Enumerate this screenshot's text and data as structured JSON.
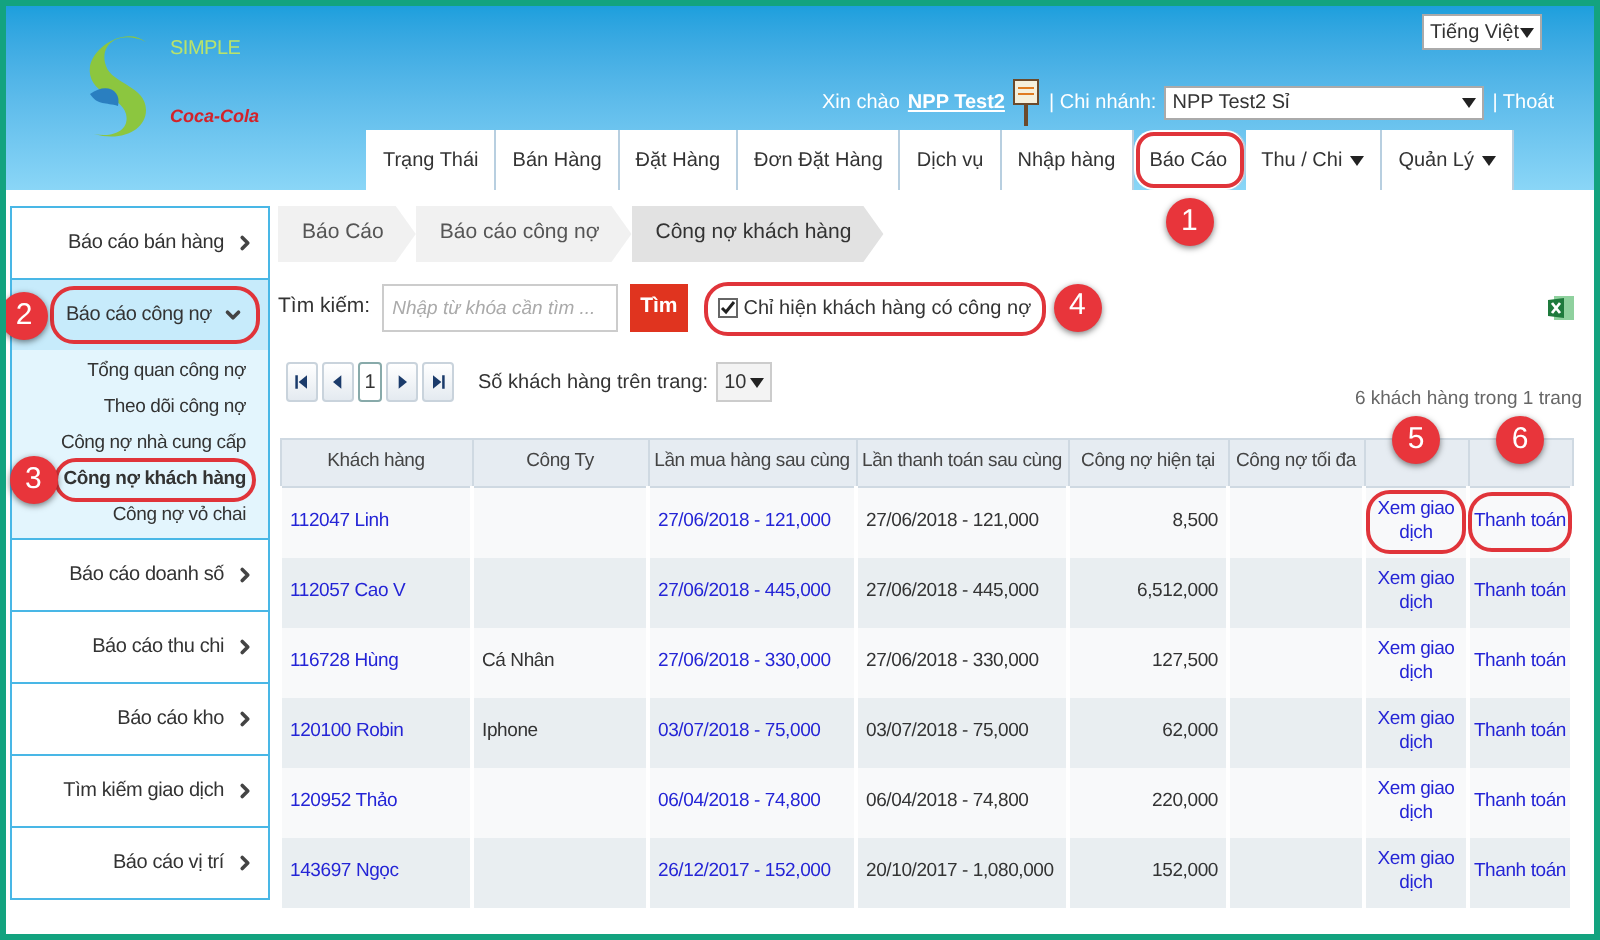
{
  "header": {
    "logo": {
      "text": "SIMPLE",
      "brand": "Coca-Cola"
    },
    "language": "Tiếng Việt",
    "greeting": "Xin chào",
    "user": "NPP Test2",
    "branch_label": "| Chi nhánh:",
    "branch": "NPP Test2 Sỉ",
    "logout": "| Thoát"
  },
  "tabs": [
    {
      "label": "Trạng Thái",
      "selected": false,
      "menu": false
    },
    {
      "label": "Bán Hàng",
      "selected": false,
      "menu": false
    },
    {
      "label": "Đặt Hàng",
      "selected": false,
      "menu": false
    },
    {
      "label": "Đơn Đặt Hàng",
      "selected": false,
      "menu": false
    },
    {
      "label": "Dịch vụ",
      "selected": false,
      "menu": false
    },
    {
      "label": "Nhập hàng",
      "selected": false,
      "menu": false
    },
    {
      "label": "Báo Cáo",
      "selected": true,
      "menu": false,
      "callout": "1"
    },
    {
      "label": "Thu / Chi",
      "selected": false,
      "menu": true
    },
    {
      "label": "Quản Lý",
      "selected": false,
      "menu": true
    }
  ],
  "sidebar": {
    "items": [
      {
        "label": "Báo cáo bán hàng",
        "expanded": false
      },
      {
        "label": "Báo cáo công nợ",
        "expanded": true,
        "callout": "2",
        "children": [
          {
            "label": "Tổng quan công nợ",
            "selected": false
          },
          {
            "label": "Theo dõi công nợ",
            "selected": false
          },
          {
            "label": "Công nợ nhà cung cấp",
            "selected": false
          },
          {
            "label": "Công nợ khách hàng",
            "selected": true,
            "callout": "3"
          },
          {
            "label": "Công nợ vỏ chai",
            "selected": false
          }
        ]
      },
      {
        "label": "Báo cáo doanh số",
        "expanded": false
      },
      {
        "label": "Báo cáo thu chi",
        "expanded": false
      },
      {
        "label": "Báo cáo kho",
        "expanded": false
      },
      {
        "label": "Tìm kiếm giao dịch",
        "expanded": false
      },
      {
        "label": "Báo cáo vị trí",
        "expanded": false
      }
    ]
  },
  "breadcrumb": [
    "Báo Cáo",
    "Báo cáo công nợ",
    "Công nợ khách hàng"
  ],
  "search": {
    "label": "Tìm kiếm:",
    "placeholder": "Nhập từ khóa cần tìm ...",
    "button": "Tìm",
    "filter": {
      "label": "Chỉ hiện khách hàng có công nợ",
      "checked": true,
      "callout": "4"
    }
  },
  "pager": {
    "page": "1",
    "page_size_label": "Số khách hàng trên trang:",
    "page_size": "10",
    "summary": "6 khách hàng trong 1 trang"
  },
  "table": {
    "columns": [
      {
        "label": "Khách hàng"
      },
      {
        "label": "Công Ty"
      },
      {
        "label": "Lần mua hàng sau cùng"
      },
      {
        "label": "Lần thanh toán sau cùng"
      },
      {
        "label": "Công nợ hiện tại"
      },
      {
        "label": "Công nợ tối đa"
      },
      {
        "callout": "5"
      },
      {
        "callout": "6"
      }
    ],
    "rows": [
      {
        "customer": "112047 Linh",
        "company": "",
        "last_purchase": "27/06/2018 - 121,000",
        "last_payment": "27/06/2018 - 121,000",
        "current_debt": "8,500",
        "view": {
          "label": "Xem giao dịch",
          "highlighted": true
        },
        "pay": {
          "label": "Thanh toán",
          "highlighted": true
        }
      },
      {
        "customer": "112057 Cao V",
        "company": "",
        "last_purchase": "27/06/2018 - 445,000",
        "last_payment": "27/06/2018 - 445,000",
        "current_debt": "6,512,000",
        "view": {
          "label": "Xem giao dịch",
          "highlighted": false
        },
        "pay": {
          "label": "Thanh toán",
          "highlighted": false
        }
      },
      {
        "customer": "116728 Hùng",
        "company": "Cá Nhân",
        "last_purchase": "27/06/2018 - 330,000",
        "last_payment": "27/06/2018 - 330,000",
        "current_debt": "127,500",
        "view": {
          "label": "Xem giao dịch",
          "highlighted": false
        },
        "pay": {
          "label": "Thanh toán",
          "highlighted": false
        }
      },
      {
        "customer": "120100 Robin",
        "company": "Iphone",
        "last_purchase": "03/07/2018 - 75,000",
        "last_payment": "03/07/2018 - 75,000",
        "current_debt": "62,000",
        "view": {
          "label": "Xem giao dịch",
          "highlighted": false
        },
        "pay": {
          "label": "Thanh toán",
          "highlighted": false
        }
      },
      {
        "customer": "120952 Thảo",
        "company": "",
        "last_purchase": "06/04/2018 - 74,800",
        "last_payment": "06/04/2018 - 74,800",
        "current_debt": "220,000",
        "view": {
          "label": "Xem giao dịch",
          "highlighted": false
        },
        "pay": {
          "label": "Thanh toán",
          "highlighted": false
        }
      },
      {
        "customer": "143697 Ngọc",
        "company": "",
        "last_purchase": "26/12/2017 - 152,000",
        "last_payment": "20/10/2017 - 1,080,000",
        "current_debt": "152,000",
        "view": {
          "label": "Xem giao dịch",
          "highlighted": false
        },
        "pay": {
          "label": "Thanh toán",
          "highlighted": false
        }
      }
    ]
  }
}
